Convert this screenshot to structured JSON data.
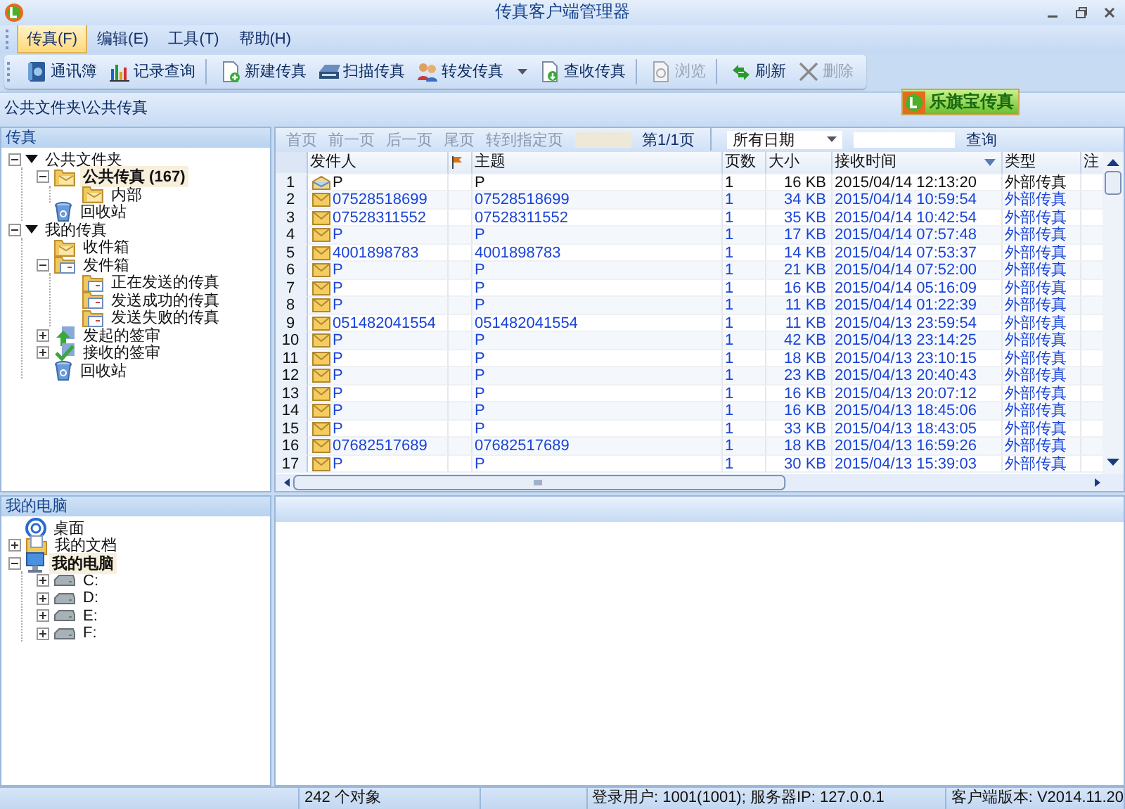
{
  "window": {
    "title": "传真客户端管理器"
  },
  "menu": [
    {
      "label": "传真(F)",
      "selected": true
    },
    {
      "label": "编辑(E)",
      "selected": false
    },
    {
      "label": "工具(T)",
      "selected": false
    },
    {
      "label": "帮助(H)",
      "selected": false
    }
  ],
  "toolbar": [
    {
      "label": "通讯簿",
      "kind": "book",
      "disabled": false,
      "dropdown": false,
      "separator_after": false
    },
    {
      "label": "记录查询",
      "kind": "chart",
      "disabled": false,
      "dropdown": false,
      "separator_after": true
    },
    {
      "label": "新建传真",
      "kind": "new",
      "disabled": false,
      "dropdown": false,
      "separator_after": false
    },
    {
      "label": "扫描传真",
      "kind": "scan",
      "disabled": false,
      "dropdown": false,
      "separator_after": false
    },
    {
      "label": "转发传真",
      "kind": "forward",
      "disabled": false,
      "dropdown": true,
      "separator_after": false
    },
    {
      "label": "查收传真",
      "kind": "receive",
      "disabled": false,
      "dropdown": false,
      "separator_after": true
    },
    {
      "label": "浏览",
      "kind": "browse",
      "disabled": true,
      "dropdown": false,
      "separator_after": true
    },
    {
      "label": "刷新",
      "kind": "refresh",
      "disabled": false,
      "dropdown": false,
      "separator_after": false
    },
    {
      "label": "删除",
      "kind": "delete",
      "disabled": true,
      "dropdown": false,
      "separator_after": false
    }
  ],
  "path": "公共文件夹\\公共传真",
  "brand": "乐旗宝传真",
  "fax_tree": {
    "title": "传真",
    "items": [
      {
        "label": "公共文件夹",
        "kind": "group",
        "expanded": true,
        "selected": false,
        "children": [
          {
            "label": "公共传真 (167)",
            "kind": "mail-folder",
            "expanded": true,
            "selected": true,
            "children": [
              {
                "label": "内部",
                "kind": "mail-folder",
                "selected": false
              }
            ]
          },
          {
            "label": "回收站",
            "kind": "recycle",
            "selected": false
          }
        ]
      },
      {
        "label": "我的传真",
        "kind": "group",
        "expanded": true,
        "selected": false,
        "children": [
          {
            "label": "收件箱",
            "kind": "mail-folder",
            "selected": false
          },
          {
            "label": "发件箱",
            "kind": "out-folder",
            "expanded": true,
            "selected": false,
            "children": [
              {
                "label": "正在发送的传真",
                "kind": "out-folder",
                "selected": false
              },
              {
                "label": "发送成功的传真",
                "kind": "out-folder",
                "selected": false
              },
              {
                "label": "发送失败的传真",
                "kind": "out-folder",
                "selected": false
              }
            ]
          },
          {
            "label": "发起的签审",
            "kind": "sign-out",
            "expanded": false,
            "selected": false
          },
          {
            "label": "接收的签审",
            "kind": "sign-in",
            "expanded": false,
            "selected": false
          },
          {
            "label": "回收站",
            "kind": "recycle",
            "selected": false
          }
        ]
      }
    ]
  },
  "pc_tree": {
    "title": "我的电脑",
    "items": [
      {
        "label": "桌面",
        "kind": "desktop",
        "selected": false
      },
      {
        "label": "我的文档",
        "kind": "documents",
        "expanded": false,
        "selected": false
      },
      {
        "label": "我的电脑",
        "kind": "computer",
        "expanded": true,
        "selected": true,
        "children": [
          {
            "label": "C:",
            "kind": "drive",
            "expanded": false,
            "selected": false
          },
          {
            "label": "D:",
            "kind": "drive",
            "expanded": false,
            "selected": false
          },
          {
            "label": "E:",
            "kind": "drive",
            "expanded": false,
            "selected": false
          },
          {
            "label": "F:",
            "kind": "drive",
            "expanded": false,
            "selected": false
          }
        ]
      }
    ]
  },
  "pager": {
    "first": "首页",
    "prev": "前一页",
    "next": "后一页",
    "last": "尾页",
    "goto": "转到指定页",
    "page": "第1/1页",
    "date_filter": "所有日期",
    "search": "查询"
  },
  "table": {
    "columns": [
      "发件人",
      "",
      "主题",
      "页数",
      "大小",
      "接收时间",
      "类型",
      "注"
    ],
    "rows": [
      {
        "no": "1",
        "sender": "P",
        "subject": "P",
        "pages": "1",
        "size": "16 KB",
        "time": "2015/04/14 12:13:20",
        "type": "外部传真",
        "read": true
      },
      {
        "no": "2",
        "sender": "07528518699",
        "subject": "07528518699",
        "pages": "1",
        "size": "34 KB",
        "time": "2015/04/14 10:59:54",
        "type": "外部传真",
        "read": false
      },
      {
        "no": "3",
        "sender": "07528311552",
        "subject": "07528311552",
        "pages": "1",
        "size": "35 KB",
        "time": "2015/04/14 10:42:54",
        "type": "外部传真",
        "read": false
      },
      {
        "no": "4",
        "sender": "P",
        "subject": "P",
        "pages": "1",
        "size": "17 KB",
        "time": "2015/04/14 07:57:48",
        "type": "外部传真",
        "read": false
      },
      {
        "no": "5",
        "sender": "4001898783",
        "subject": "4001898783",
        "pages": "1",
        "size": "14 KB",
        "time": "2015/04/14 07:53:37",
        "type": "外部传真",
        "read": false
      },
      {
        "no": "6",
        "sender": "P",
        "subject": "P",
        "pages": "1",
        "size": "21 KB",
        "time": "2015/04/14 07:52:00",
        "type": "外部传真",
        "read": false
      },
      {
        "no": "7",
        "sender": "P",
        "subject": "P",
        "pages": "1",
        "size": "16 KB",
        "time": "2015/04/14 05:16:09",
        "type": "外部传真",
        "read": false
      },
      {
        "no": "8",
        "sender": "P",
        "subject": "P",
        "pages": "1",
        "size": "11 KB",
        "time": "2015/04/14 01:22:39",
        "type": "外部传真",
        "read": false
      },
      {
        "no": "9",
        "sender": "051482041554",
        "subject": "051482041554",
        "pages": "1",
        "size": "11 KB",
        "time": "2015/04/13 23:59:54",
        "type": "外部传真",
        "read": false
      },
      {
        "no": "10",
        "sender": "P",
        "subject": "P",
        "pages": "1",
        "size": "42 KB",
        "time": "2015/04/13 23:14:25",
        "type": "外部传真",
        "read": false
      },
      {
        "no": "11",
        "sender": "P",
        "subject": "P",
        "pages": "1",
        "size": "18 KB",
        "time": "2015/04/13 23:10:15",
        "type": "外部传真",
        "read": false
      },
      {
        "no": "12",
        "sender": "P",
        "subject": "P",
        "pages": "1",
        "size": "23 KB",
        "time": "2015/04/13 20:40:43",
        "type": "外部传真",
        "read": false
      },
      {
        "no": "13",
        "sender": "P",
        "subject": "P",
        "pages": "1",
        "size": "16 KB",
        "time": "2015/04/13 20:07:12",
        "type": "外部传真",
        "read": false
      },
      {
        "no": "14",
        "sender": "P",
        "subject": "P",
        "pages": "1",
        "size": "16 KB",
        "time": "2015/04/13 18:45:06",
        "type": "外部传真",
        "read": false
      },
      {
        "no": "15",
        "sender": "P",
        "subject": "P",
        "pages": "1",
        "size": "33 KB",
        "time": "2015/04/13 18:43:05",
        "type": "外部传真",
        "read": false
      },
      {
        "no": "16",
        "sender": "07682517689",
        "subject": "07682517689",
        "pages": "1",
        "size": "18 KB",
        "time": "2015/04/13 16:59:26",
        "type": "外部传真",
        "read": false
      },
      {
        "no": "17",
        "sender": "P",
        "subject": "P",
        "pages": "1",
        "size": "30 KB",
        "time": "2015/04/13 15:39:03",
        "type": "外部传真",
        "read": false
      }
    ]
  },
  "status_bar": [
    "242 个对象",
    "登录用户: 1001(1001); 服务器IP: 127.0.0.1",
    "客户端版本: V2014.11.20"
  ]
}
